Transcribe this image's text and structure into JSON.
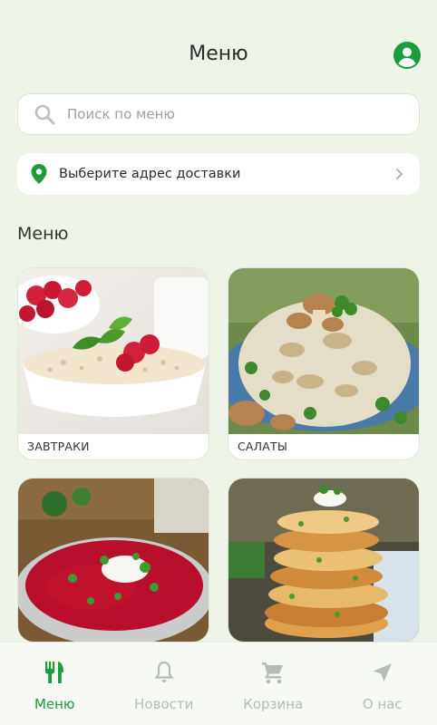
{
  "header": {
    "title": "Меню",
    "profile_icon": "account-circle-icon"
  },
  "search": {
    "placeholder": "Поиск по меню",
    "value": ""
  },
  "address": {
    "label": "Выберите адрес доставки"
  },
  "menu": {
    "section_title": "Меню",
    "categories": [
      {
        "label": "ЗАВТРАКИ",
        "image": "porridge-with-raspberries"
      },
      {
        "label": "САЛАТЫ",
        "image": "mushroom-salad"
      },
      {
        "label": "",
        "image": "borscht-with-sour-cream"
      },
      {
        "label": "",
        "image": "stack-of-pancakes"
      }
    ]
  },
  "nav": {
    "items": [
      {
        "label": "Меню",
        "icon": "fork-knife-icon",
        "active": true
      },
      {
        "label": "Новости",
        "icon": "bell-icon",
        "active": false
      },
      {
        "label": "Корзина",
        "icon": "cart-icon",
        "active": false
      },
      {
        "label": "О нас",
        "icon": "navigation-arrow-icon",
        "active": false
      }
    ]
  },
  "colors": {
    "accent": "#1a9d3a",
    "background": "#eef5e8",
    "inactive": "#b3bfb1"
  }
}
